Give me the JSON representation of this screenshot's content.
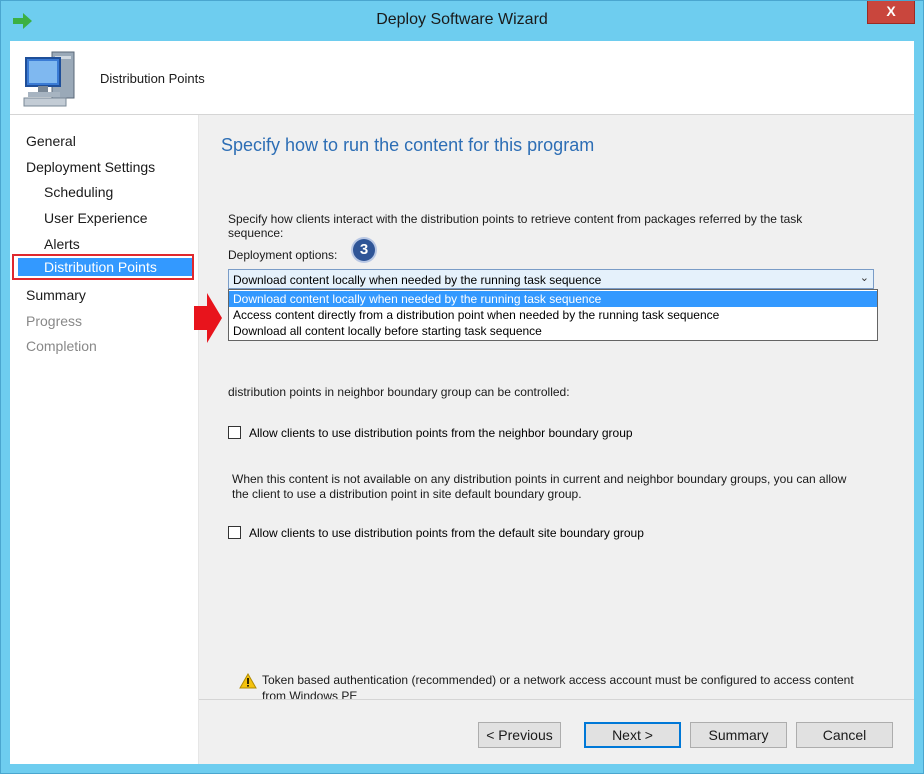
{
  "window": {
    "title": "Deploy Software Wizard",
    "close_label": "X"
  },
  "header": {
    "title": "Distribution Points"
  },
  "nav": {
    "items": [
      {
        "label": "General"
      },
      {
        "label": "Deployment Settings"
      },
      {
        "label": "Scheduling"
      },
      {
        "label": "User Experience"
      },
      {
        "label": "Alerts"
      },
      {
        "label": "Distribution Points"
      },
      {
        "label": "Summary"
      },
      {
        "label": "Progress"
      },
      {
        "label": "Completion"
      }
    ]
  },
  "page": {
    "heading": "Specify how to run the content for this program",
    "intro_line1": "Specify how clients interact with the distribution points to retrieve content from packages referred by the task",
    "intro_line2": "sequence:",
    "deployment_options_label": "Deployment options:",
    "step_badge": "3",
    "combo_value": "Download content locally when needed by the running task sequence",
    "dropdown_options": [
      "Download content locally when needed by the running task sequence",
      "Access content directly from a distribution point when needed by the running task sequence",
      "Download all content locally before starting task sequence"
    ],
    "neighbor_text": "distribution points in neighbor boundary group can be controlled:",
    "neighbor_checkbox_label": "Allow clients to use distribution points from the neighbor boundary group",
    "default_text_line1": "When this content is not available on any distribution points in current and neighbor boundary groups, you can allow",
    "default_text_line2": "the client to use a distribution point in site default boundary group.",
    "default_checkbox_label": "Allow clients to use distribution points from the default site boundary group",
    "warning_line1": "Token based authentication (recommended) or a network access account must be configured to access content",
    "warning_line2": "from Windows PE"
  },
  "buttons": {
    "previous": "< Previous",
    "next": "Next >",
    "summary": "Summary",
    "cancel": "Cancel"
  },
  "colors": {
    "accent": "#3399ff",
    "heading": "#2d6eb5",
    "highlight_border": "#e0282e",
    "annotation_arrow": "#e8141c",
    "badge": "#2f5597"
  }
}
